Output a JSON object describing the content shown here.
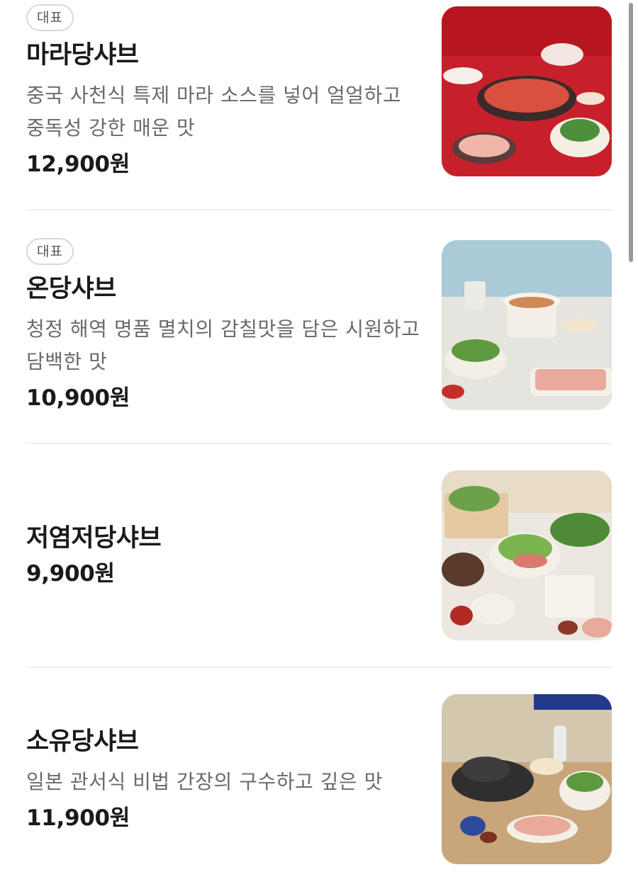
{
  "menu": {
    "items": [
      {
        "badge": "대표",
        "name": "마라당샤브",
        "description": "중국 사천식 특제 마라 소스를 넣어 얼얼하고 중독성 강한 매운 맛",
        "price": "12,900원",
        "image_icon": "mala-shabu-photo"
      },
      {
        "badge": "대표",
        "name": "온당샤브",
        "description": "청정 해역 명품 멸치의 감칠맛을 담은 시원하고 담백한 맛",
        "price": "10,900원",
        "image_icon": "ondang-shabu-photo"
      },
      {
        "badge": "",
        "name": "저염저당샤브",
        "description": "",
        "price": "9,900원",
        "image_icon": "low-salt-low-sugar-shabu-photo"
      },
      {
        "badge": "",
        "name": "소유당샤브",
        "description": "일본 관서식 비법 간장의 구수하고 깊은 맛",
        "price": "11,900원",
        "image_icon": "soy-shabu-photo"
      }
    ]
  },
  "colors": {
    "mala_background": "#c8202a",
    "ondang_background": "#a9cad6",
    "lowsalt_background": "#e8dcc6",
    "soy_background": "#d3c7ad"
  }
}
